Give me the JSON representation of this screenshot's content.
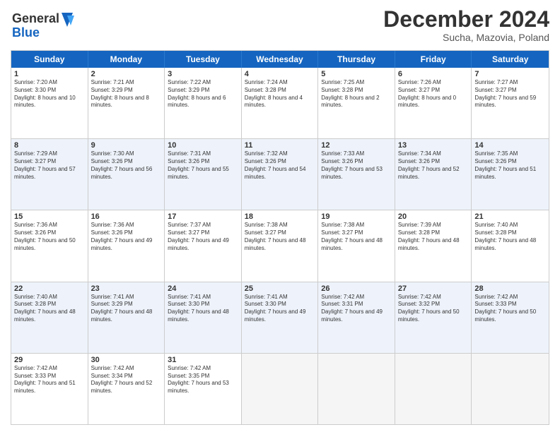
{
  "header": {
    "logo_line1": "General",
    "logo_line2": "Blue",
    "month": "December 2024",
    "location": "Sucha, Mazovia, Poland"
  },
  "weekdays": [
    "Sunday",
    "Monday",
    "Tuesday",
    "Wednesday",
    "Thursday",
    "Friday",
    "Saturday"
  ],
  "weeks": [
    [
      {
        "day": "1",
        "sunrise": "Sunrise: 7:20 AM",
        "sunset": "Sunset: 3:30 PM",
        "daylight": "Daylight: 8 hours and 10 minutes."
      },
      {
        "day": "2",
        "sunrise": "Sunrise: 7:21 AM",
        "sunset": "Sunset: 3:29 PM",
        "daylight": "Daylight: 8 hours and 8 minutes."
      },
      {
        "day": "3",
        "sunrise": "Sunrise: 7:22 AM",
        "sunset": "Sunset: 3:29 PM",
        "daylight": "Daylight: 8 hours and 6 minutes."
      },
      {
        "day": "4",
        "sunrise": "Sunrise: 7:24 AM",
        "sunset": "Sunset: 3:28 PM",
        "daylight": "Daylight: 8 hours and 4 minutes."
      },
      {
        "day": "5",
        "sunrise": "Sunrise: 7:25 AM",
        "sunset": "Sunset: 3:28 PM",
        "daylight": "Daylight: 8 hours and 2 minutes."
      },
      {
        "day": "6",
        "sunrise": "Sunrise: 7:26 AM",
        "sunset": "Sunset: 3:27 PM",
        "daylight": "Daylight: 8 hours and 0 minutes."
      },
      {
        "day": "7",
        "sunrise": "Sunrise: 7:27 AM",
        "sunset": "Sunset: 3:27 PM",
        "daylight": "Daylight: 7 hours and 59 minutes."
      }
    ],
    [
      {
        "day": "8",
        "sunrise": "Sunrise: 7:29 AM",
        "sunset": "Sunset: 3:27 PM",
        "daylight": "Daylight: 7 hours and 57 minutes."
      },
      {
        "day": "9",
        "sunrise": "Sunrise: 7:30 AM",
        "sunset": "Sunset: 3:26 PM",
        "daylight": "Daylight: 7 hours and 56 minutes."
      },
      {
        "day": "10",
        "sunrise": "Sunrise: 7:31 AM",
        "sunset": "Sunset: 3:26 PM",
        "daylight": "Daylight: 7 hours and 55 minutes."
      },
      {
        "day": "11",
        "sunrise": "Sunrise: 7:32 AM",
        "sunset": "Sunset: 3:26 PM",
        "daylight": "Daylight: 7 hours and 54 minutes."
      },
      {
        "day": "12",
        "sunrise": "Sunrise: 7:33 AM",
        "sunset": "Sunset: 3:26 PM",
        "daylight": "Daylight: 7 hours and 53 minutes."
      },
      {
        "day": "13",
        "sunrise": "Sunrise: 7:34 AM",
        "sunset": "Sunset: 3:26 PM",
        "daylight": "Daylight: 7 hours and 52 minutes."
      },
      {
        "day": "14",
        "sunrise": "Sunrise: 7:35 AM",
        "sunset": "Sunset: 3:26 PM",
        "daylight": "Daylight: 7 hours and 51 minutes."
      }
    ],
    [
      {
        "day": "15",
        "sunrise": "Sunrise: 7:36 AM",
        "sunset": "Sunset: 3:26 PM",
        "daylight": "Daylight: 7 hours and 50 minutes."
      },
      {
        "day": "16",
        "sunrise": "Sunrise: 7:36 AM",
        "sunset": "Sunset: 3:26 PM",
        "daylight": "Daylight: 7 hours and 49 minutes."
      },
      {
        "day": "17",
        "sunrise": "Sunrise: 7:37 AM",
        "sunset": "Sunset: 3:27 PM",
        "daylight": "Daylight: 7 hours and 49 minutes."
      },
      {
        "day": "18",
        "sunrise": "Sunrise: 7:38 AM",
        "sunset": "Sunset: 3:27 PM",
        "daylight": "Daylight: 7 hours and 48 minutes."
      },
      {
        "day": "19",
        "sunrise": "Sunrise: 7:38 AM",
        "sunset": "Sunset: 3:27 PM",
        "daylight": "Daylight: 7 hours and 48 minutes."
      },
      {
        "day": "20",
        "sunrise": "Sunrise: 7:39 AM",
        "sunset": "Sunset: 3:28 PM",
        "daylight": "Daylight: 7 hours and 48 minutes."
      },
      {
        "day": "21",
        "sunrise": "Sunrise: 7:40 AM",
        "sunset": "Sunset: 3:28 PM",
        "daylight": "Daylight: 7 hours and 48 minutes."
      }
    ],
    [
      {
        "day": "22",
        "sunrise": "Sunrise: 7:40 AM",
        "sunset": "Sunset: 3:28 PM",
        "daylight": "Daylight: 7 hours and 48 minutes."
      },
      {
        "day": "23",
        "sunrise": "Sunrise: 7:41 AM",
        "sunset": "Sunset: 3:29 PM",
        "daylight": "Daylight: 7 hours and 48 minutes."
      },
      {
        "day": "24",
        "sunrise": "Sunrise: 7:41 AM",
        "sunset": "Sunset: 3:30 PM",
        "daylight": "Daylight: 7 hours and 48 minutes."
      },
      {
        "day": "25",
        "sunrise": "Sunrise: 7:41 AM",
        "sunset": "Sunset: 3:30 PM",
        "daylight": "Daylight: 7 hours and 49 minutes."
      },
      {
        "day": "26",
        "sunrise": "Sunrise: 7:42 AM",
        "sunset": "Sunset: 3:31 PM",
        "daylight": "Daylight: 7 hours and 49 minutes."
      },
      {
        "day": "27",
        "sunrise": "Sunrise: 7:42 AM",
        "sunset": "Sunset: 3:32 PM",
        "daylight": "Daylight: 7 hours and 50 minutes."
      },
      {
        "day": "28",
        "sunrise": "Sunrise: 7:42 AM",
        "sunset": "Sunset: 3:33 PM",
        "daylight": "Daylight: 7 hours and 50 minutes."
      }
    ],
    [
      {
        "day": "29",
        "sunrise": "Sunrise: 7:42 AM",
        "sunset": "Sunset: 3:33 PM",
        "daylight": "Daylight: 7 hours and 51 minutes."
      },
      {
        "day": "30",
        "sunrise": "Sunrise: 7:42 AM",
        "sunset": "Sunset: 3:34 PM",
        "daylight": "Daylight: 7 hours and 52 minutes."
      },
      {
        "day": "31",
        "sunrise": "Sunrise: 7:42 AM",
        "sunset": "Sunset: 3:35 PM",
        "daylight": "Daylight: 7 hours and 53 minutes."
      },
      null,
      null,
      null,
      null
    ]
  ]
}
